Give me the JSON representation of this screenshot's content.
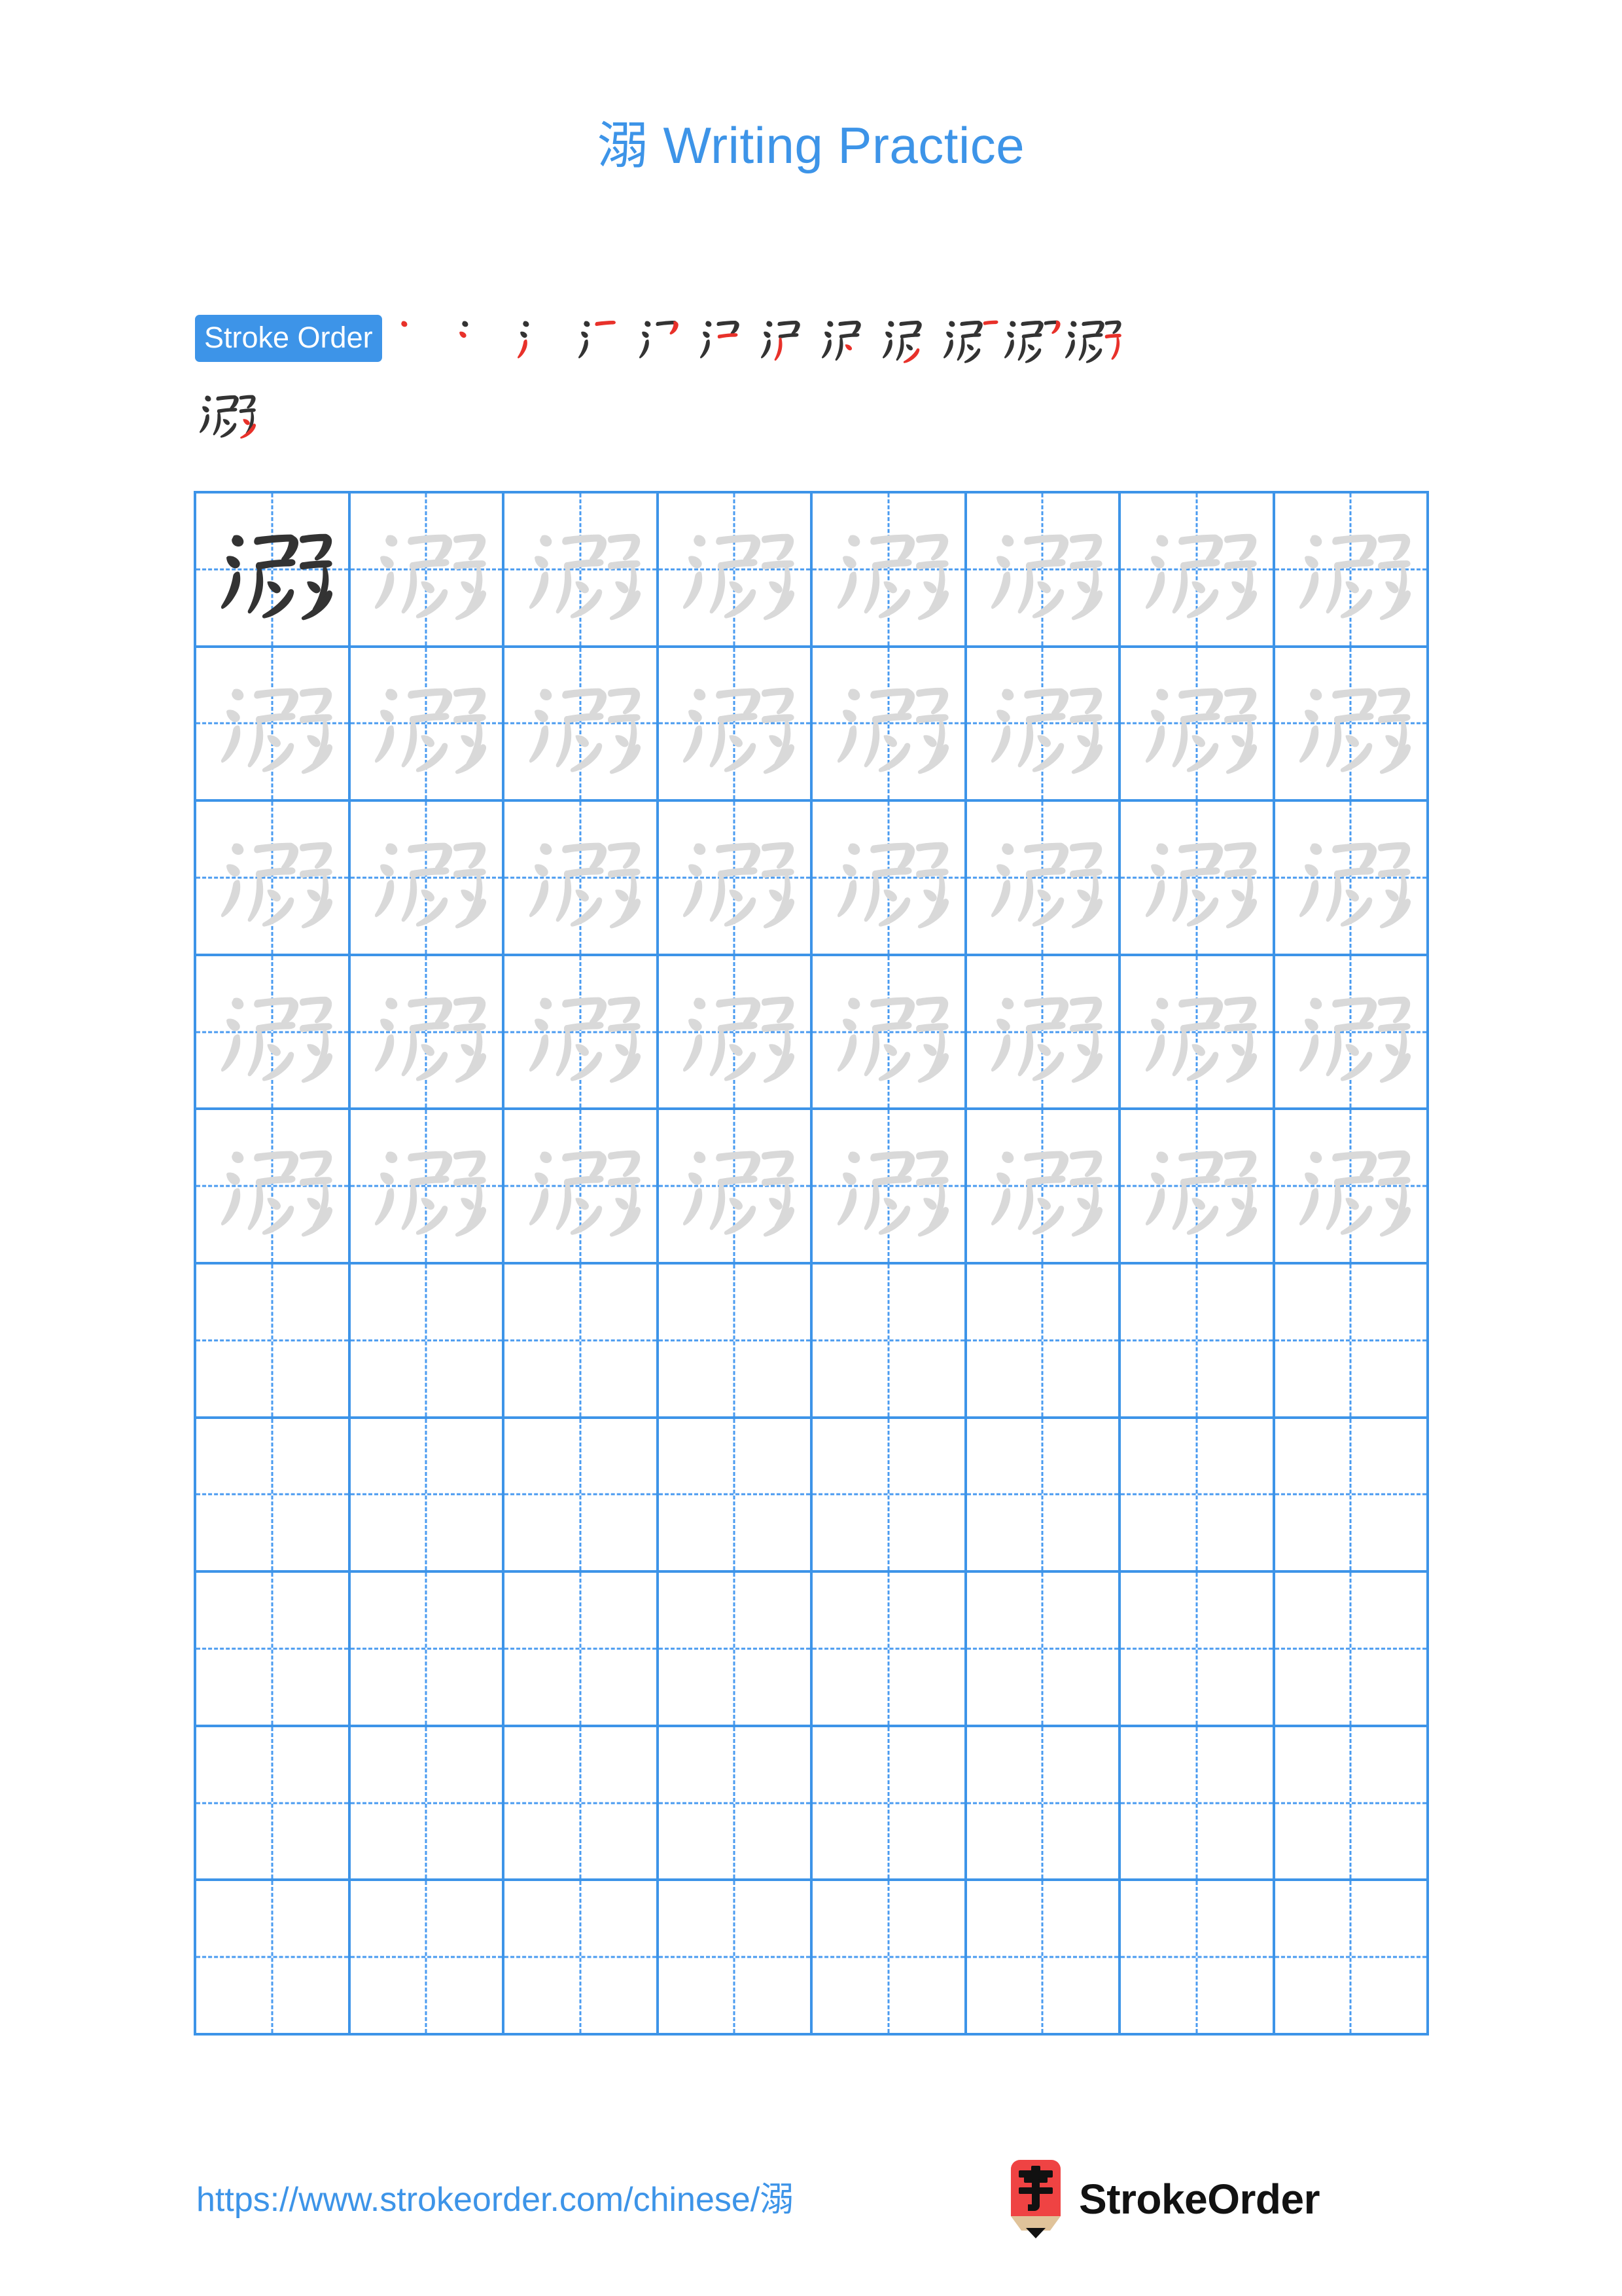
{
  "character": "溺",
  "title": "溺 Writing Practice",
  "colors": {
    "accent_blue": "#3d94e8",
    "grid_line": "#3d94e8",
    "grid_dash": "#4a9bf0",
    "model_char": "#333333",
    "trace_char": "#d9d9d9",
    "new_stroke": "#e8312a",
    "logo_red": "#ef4343",
    "logo_wood": "#e0c39a"
  },
  "stroke_order": {
    "badge_label": "Stroke Order",
    "total_strokes": 13,
    "steps": [
      {
        "index": 1,
        "label": "溺 stroke 1"
      },
      {
        "index": 2,
        "label": "溺 stroke 2"
      },
      {
        "index": 3,
        "label": "溺 stroke 3"
      },
      {
        "index": 4,
        "label": "溺 stroke 4"
      },
      {
        "index": 5,
        "label": "溺 stroke 5"
      },
      {
        "index": 6,
        "label": "溺 stroke 6"
      },
      {
        "index": 7,
        "label": "溺 stroke 7"
      },
      {
        "index": 8,
        "label": "溺 stroke 8"
      },
      {
        "index": 9,
        "label": "溺 stroke 9"
      },
      {
        "index": 10,
        "label": "溺 stroke 10"
      },
      {
        "index": 11,
        "label": "溺 stroke 11"
      },
      {
        "index": 12,
        "label": "溺 stroke 12"
      },
      {
        "index": 13,
        "label": "溺 stroke 13"
      }
    ]
  },
  "grid": {
    "columns": 8,
    "rows": 10,
    "filled_rows": 5,
    "model_cell": {
      "row": 1,
      "col": 1
    }
  },
  "footer": {
    "url": "https://www.strokeorder.com/chinese/溺",
    "brand": "StrokeOrder",
    "logo_glyph": "字"
  }
}
